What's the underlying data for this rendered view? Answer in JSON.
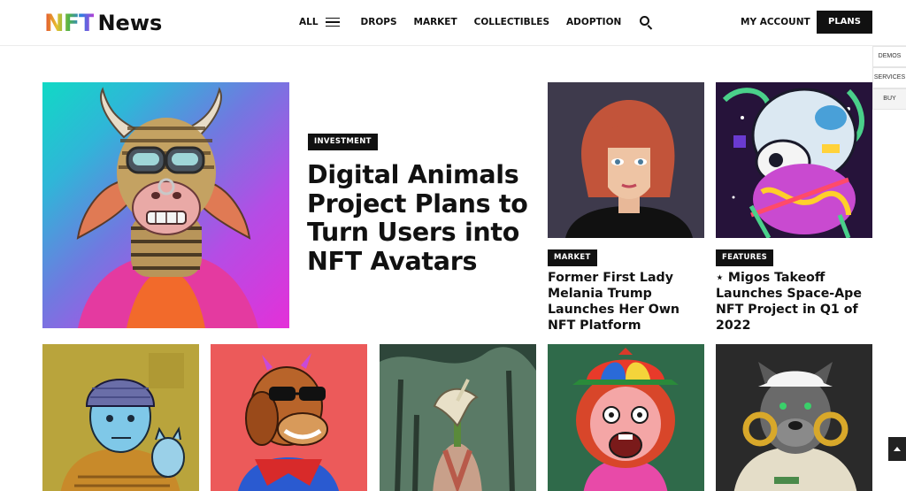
{
  "header": {
    "logo_nft": "NFT",
    "logo_news": "News",
    "nav": [
      "ALL",
      "DROPS",
      "MARKET",
      "COLLECTIBLES",
      "ADOPTION"
    ],
    "account": "MY ACCOUNT",
    "plans": "PLANS"
  },
  "side_tabs": [
    "DEMOS",
    "SERVICES",
    "BUY"
  ],
  "feature": {
    "badge": "INVESTMENT",
    "title": "Digital Animals Project Plans to Turn Users into NFT Avatars"
  },
  "cards": [
    {
      "badge": "MARKET",
      "title": "Former First Lady Melania Trump Launches Her Own NFT Platform"
    },
    {
      "badge": "FEATURES",
      "title": "⋆ Migos Takeoff Launches Space-Ape NFT Project in Q1 of 2022"
    }
  ],
  "icons": {
    "menu": "hamburger-icon",
    "search": "search-icon",
    "back_to_top": "arrow-up-icon"
  },
  "colors": {
    "accent": "#111111",
    "background": "#ffffff"
  }
}
